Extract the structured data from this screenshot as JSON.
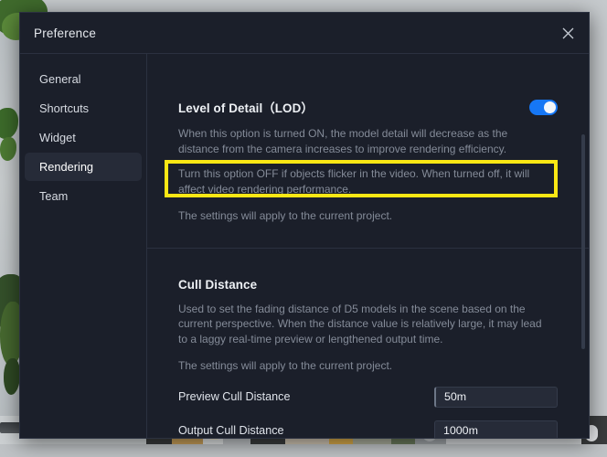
{
  "window": {
    "title": "Preference",
    "close_icon": "close-icon"
  },
  "sidebar": {
    "items": [
      {
        "label": "General",
        "selected": false
      },
      {
        "label": "Shortcuts",
        "selected": false
      },
      {
        "label": "Widget",
        "selected": false
      },
      {
        "label": "Rendering",
        "selected": true
      },
      {
        "label": "Team",
        "selected": false
      }
    ]
  },
  "sections": {
    "lod": {
      "title": "Level of Detail（LOD）",
      "description": "When this option is turned ON, the model detail will decrease as the distance from the camera increases to improve rendering efficiency.",
      "highlighted_text": "Turn this option OFF if objects flicker in the video. When turned off, it will affect video rendering performance.",
      "note": "The settings will apply to the current project.",
      "toggle_state": "on"
    },
    "cull": {
      "title": "Cull Distance",
      "description": "Used to set the fading distance of D5 models in the scene based on the current perspective. When the distance value is relatively large, it may lead to a laggy real-time preview or lengthened output time.",
      "note": "The settings will apply to the current project.",
      "rows": [
        {
          "label": "Preview Cull Distance",
          "value": "50m",
          "placeholder": "50m",
          "focused": true
        },
        {
          "label": "Output Cull Distance",
          "value": "1000m",
          "placeholder": "1000m",
          "focused": false
        }
      ]
    }
  },
  "colors": {
    "dialog_bg": "#1b1f2a",
    "accent_blue": "#1677f5",
    "annotation_yellow": "#fbe714",
    "selected_item_bg": "#262b38",
    "muted_text": "#848b98"
  }
}
